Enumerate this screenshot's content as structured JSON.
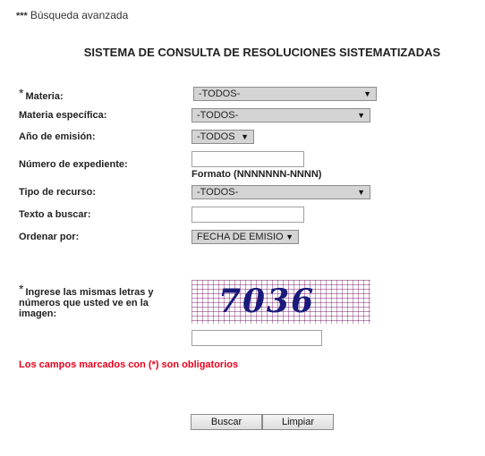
{
  "header": {
    "stars": "***",
    "advanced_search": "Búsqueda avanzada"
  },
  "title": "SISTEMA DE CONSULTA DE RESOLUCIONES SISTEMATIZADAS",
  "required_mark": "*",
  "form": {
    "materia": {
      "label": "Materia:",
      "value": "-TODOS-"
    },
    "materia_especifica": {
      "label": "Materia específica:",
      "value": "-TODOS-"
    },
    "anio_emision": {
      "label": "Año de emisión:",
      "value": "-TODOS"
    },
    "numero_expediente": {
      "label": "Número de expediente:",
      "value": "",
      "hint": "Formato (NNNNNNN-NNNN)"
    },
    "tipo_recurso": {
      "label": "Tipo de recurso:",
      "value": "-TODOS-"
    },
    "texto_buscar": {
      "label": "Texto a buscar:",
      "value": ""
    },
    "ordenar_por": {
      "label": "Ordenar por:",
      "value": "FECHA DE EMISIO"
    },
    "captcha": {
      "label_line1": "Ingrese las mismas letras y",
      "label_line2": "números que usted ve en la",
      "label_line3": "imagen:",
      "image_text": "7036",
      "value": ""
    }
  },
  "required_note": "Los campos marcados con (*) son obligatorios",
  "buttons": {
    "search": "Buscar",
    "clear": "Limpiar"
  },
  "icons": {
    "dropdown": "triangle-down-icon"
  },
  "colors": {
    "required_note": "#e8001c",
    "captcha_grid": "#7a1f6e",
    "captcha_text": "#1a1a7a"
  }
}
